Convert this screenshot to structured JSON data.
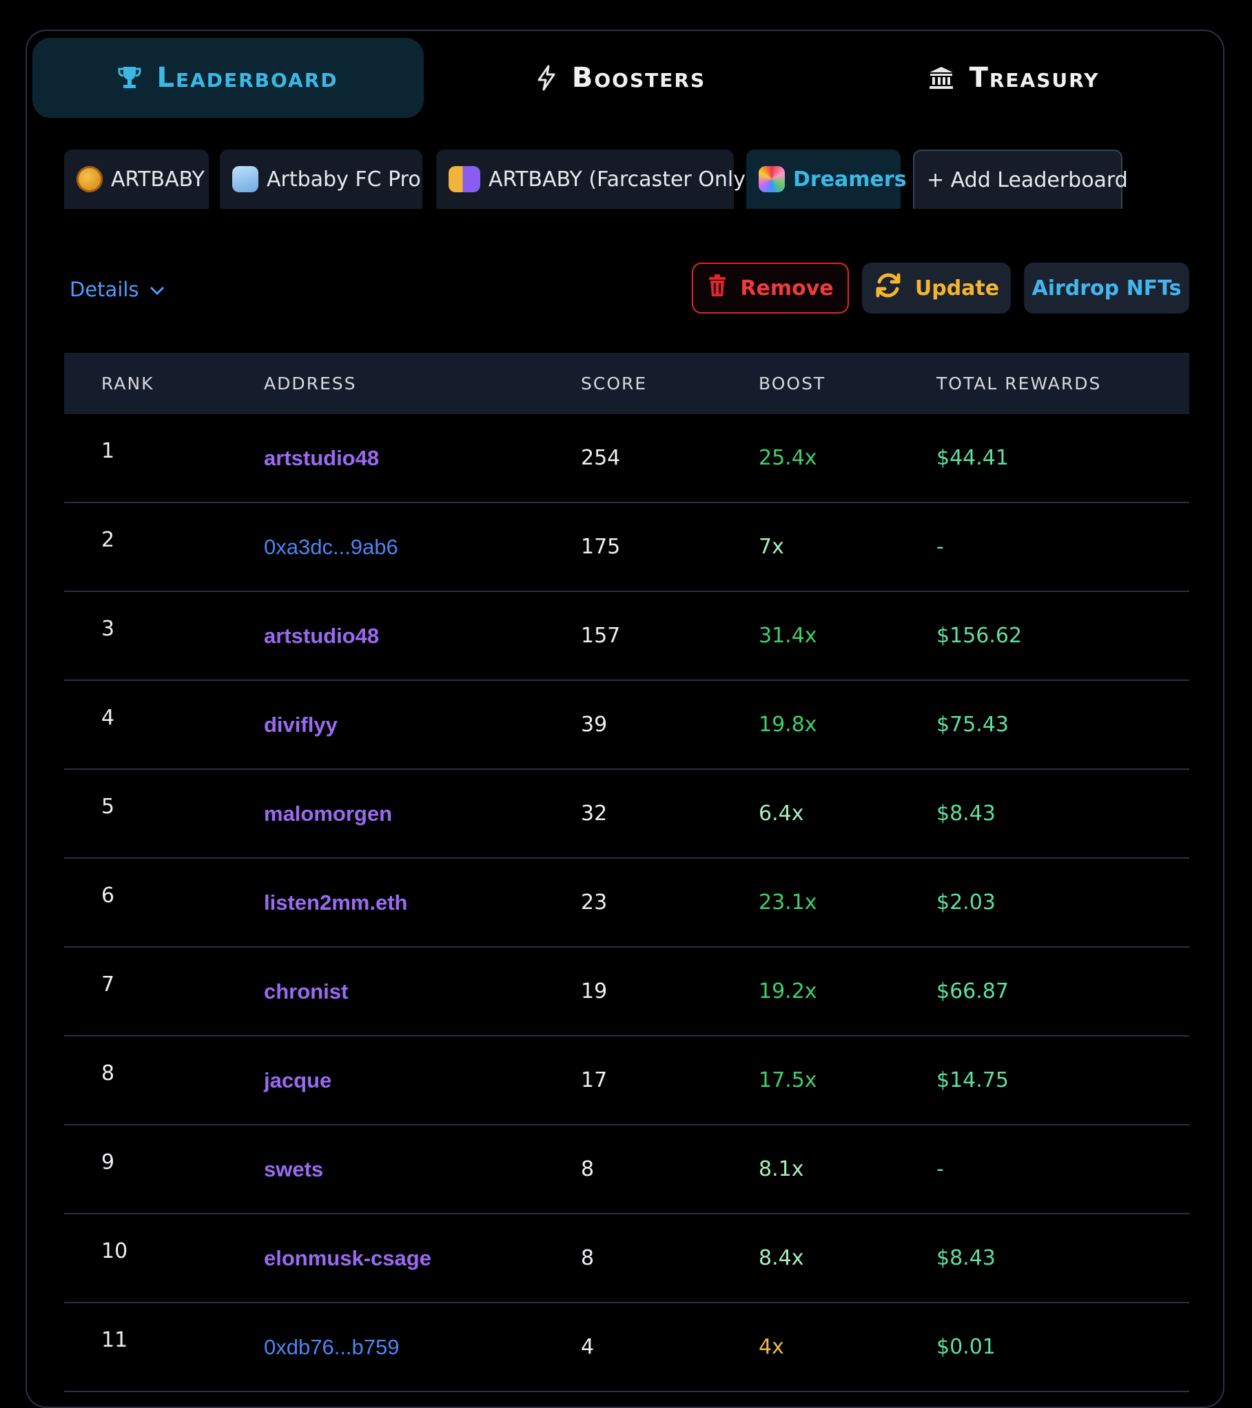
{
  "nav": {
    "tabs": [
      {
        "label": "Leaderboard",
        "icon": "trophy-icon",
        "active": true
      },
      {
        "label": "Boosters",
        "icon": "lightning-icon",
        "active": false
      },
      {
        "label": "Treasury",
        "icon": "bank-icon",
        "active": false
      }
    ]
  },
  "leaderboards": [
    {
      "label": "ARTBABY",
      "icon": "coin-icon",
      "active": false
    },
    {
      "label": "Artbaby FC Pro",
      "icon": "sailboat-icon",
      "active": false
    },
    {
      "label": "ARTBABY (Farcaster Only)",
      "icon": "coin-farcaster-icon",
      "active": false
    },
    {
      "label": "Dreamers",
      "icon": "nft-collection-icon",
      "active": true
    }
  ],
  "add_leaderboard_label": "+ Add Leaderboard",
  "details_label": "Details",
  "actions": {
    "remove_label": "Remove",
    "update_label": "Update",
    "airdrop_label": "Airdrop NFTs"
  },
  "colors": {
    "accent": "#3bb9e6",
    "boost_high": "#3ed16a",
    "boost_low": "#e9b949",
    "reward": "#5ee0a0",
    "remove": "#ef3b3b"
  },
  "table": {
    "headers": [
      "RANK",
      "ADDRESS",
      "SCORE",
      "BOOST",
      "TOTAL REWARDS"
    ],
    "rows": [
      {
        "rank": "1",
        "address": "artstudio48",
        "address_type": "name",
        "score": "254",
        "boost": "25.4x",
        "reward": "$44.41"
      },
      {
        "rank": "2",
        "address": "0xa3dc...9ab6",
        "address_type": "hex",
        "score": "175",
        "boost": "7x",
        "reward": "-"
      },
      {
        "rank": "3",
        "address": "artstudio48",
        "address_type": "name",
        "score": "157",
        "boost": "31.4x",
        "reward": "$156.62"
      },
      {
        "rank": "4",
        "address": "diviflyy",
        "address_type": "name",
        "score": "39",
        "boost": "19.8x",
        "reward": "$75.43"
      },
      {
        "rank": "5",
        "address": "malomorgen",
        "address_type": "name",
        "score": "32",
        "boost": "6.4x",
        "reward": "$8.43"
      },
      {
        "rank": "6",
        "address": "listen2mm.eth",
        "address_type": "name",
        "score": "23",
        "boost": "23.1x",
        "reward": "$2.03"
      },
      {
        "rank": "7",
        "address": "chronist",
        "address_type": "name",
        "score": "19",
        "boost": "19.2x",
        "reward": "$66.87"
      },
      {
        "rank": "8",
        "address": "jacque",
        "address_type": "name",
        "score": "17",
        "boost": "17.5x",
        "reward": "$14.75"
      },
      {
        "rank": "9",
        "address": "swets",
        "address_type": "name",
        "score": "8",
        "boost": "8.1x",
        "reward": "-"
      },
      {
        "rank": "10",
        "address": "elonmusk-csage",
        "address_type": "name",
        "score": "8",
        "boost": "8.4x",
        "reward": "$8.43"
      },
      {
        "rank": "11",
        "address": "0xdb76...b759",
        "address_type": "hex",
        "score": "4",
        "boost": "4x",
        "reward": "$0.01"
      }
    ]
  }
}
